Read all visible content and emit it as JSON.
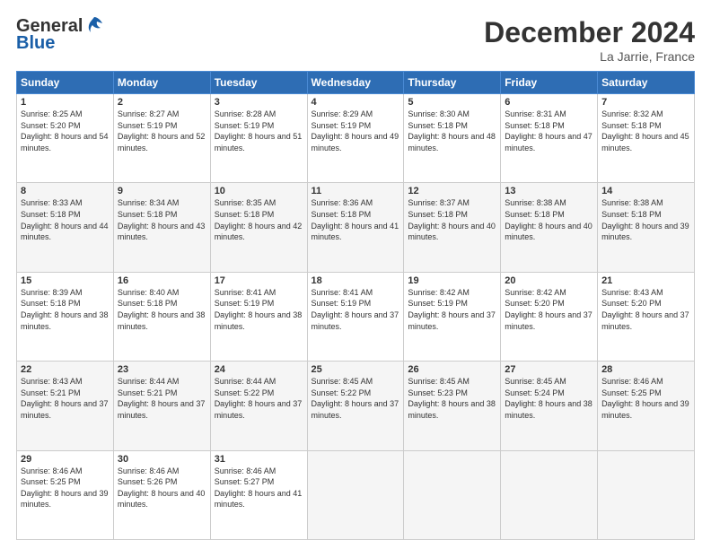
{
  "logo": {
    "line1": "General",
    "line2": "Blue"
  },
  "title": {
    "month": "December 2024",
    "location": "La Jarrie, France"
  },
  "headers": [
    "Sunday",
    "Monday",
    "Tuesday",
    "Wednesday",
    "Thursday",
    "Friday",
    "Saturday"
  ],
  "weeks": [
    [
      {
        "day": "1",
        "sunrise": "8:25 AM",
        "sunset": "5:20 PM",
        "daylight": "8 hours and 54 minutes."
      },
      {
        "day": "2",
        "sunrise": "8:27 AM",
        "sunset": "5:19 PM",
        "daylight": "8 hours and 52 minutes."
      },
      {
        "day": "3",
        "sunrise": "8:28 AM",
        "sunset": "5:19 PM",
        "daylight": "8 hours and 51 minutes."
      },
      {
        "day": "4",
        "sunrise": "8:29 AM",
        "sunset": "5:19 PM",
        "daylight": "8 hours and 49 minutes."
      },
      {
        "day": "5",
        "sunrise": "8:30 AM",
        "sunset": "5:18 PM",
        "daylight": "8 hours and 48 minutes."
      },
      {
        "day": "6",
        "sunrise": "8:31 AM",
        "sunset": "5:18 PM",
        "daylight": "8 hours and 47 minutes."
      },
      {
        "day": "7",
        "sunrise": "8:32 AM",
        "sunset": "5:18 PM",
        "daylight": "8 hours and 45 minutes."
      }
    ],
    [
      {
        "day": "8",
        "sunrise": "8:33 AM",
        "sunset": "5:18 PM",
        "daylight": "8 hours and 44 minutes."
      },
      {
        "day": "9",
        "sunrise": "8:34 AM",
        "sunset": "5:18 PM",
        "daylight": "8 hours and 43 minutes."
      },
      {
        "day": "10",
        "sunrise": "8:35 AM",
        "sunset": "5:18 PM",
        "daylight": "8 hours and 42 minutes."
      },
      {
        "day": "11",
        "sunrise": "8:36 AM",
        "sunset": "5:18 PM",
        "daylight": "8 hours and 41 minutes."
      },
      {
        "day": "12",
        "sunrise": "8:37 AM",
        "sunset": "5:18 PM",
        "daylight": "8 hours and 40 minutes."
      },
      {
        "day": "13",
        "sunrise": "8:38 AM",
        "sunset": "5:18 PM",
        "daylight": "8 hours and 40 minutes."
      },
      {
        "day": "14",
        "sunrise": "8:38 AM",
        "sunset": "5:18 PM",
        "daylight": "8 hours and 39 minutes."
      }
    ],
    [
      {
        "day": "15",
        "sunrise": "8:39 AM",
        "sunset": "5:18 PM",
        "daylight": "8 hours and 38 minutes."
      },
      {
        "day": "16",
        "sunrise": "8:40 AM",
        "sunset": "5:18 PM",
        "daylight": "8 hours and 38 minutes."
      },
      {
        "day": "17",
        "sunrise": "8:41 AM",
        "sunset": "5:19 PM",
        "daylight": "8 hours and 38 minutes."
      },
      {
        "day": "18",
        "sunrise": "8:41 AM",
        "sunset": "5:19 PM",
        "daylight": "8 hours and 37 minutes."
      },
      {
        "day": "19",
        "sunrise": "8:42 AM",
        "sunset": "5:19 PM",
        "daylight": "8 hours and 37 minutes."
      },
      {
        "day": "20",
        "sunrise": "8:42 AM",
        "sunset": "5:20 PM",
        "daylight": "8 hours and 37 minutes."
      },
      {
        "day": "21",
        "sunrise": "8:43 AM",
        "sunset": "5:20 PM",
        "daylight": "8 hours and 37 minutes."
      }
    ],
    [
      {
        "day": "22",
        "sunrise": "8:43 AM",
        "sunset": "5:21 PM",
        "daylight": "8 hours and 37 minutes."
      },
      {
        "day": "23",
        "sunrise": "8:44 AM",
        "sunset": "5:21 PM",
        "daylight": "8 hours and 37 minutes."
      },
      {
        "day": "24",
        "sunrise": "8:44 AM",
        "sunset": "5:22 PM",
        "daylight": "8 hours and 37 minutes."
      },
      {
        "day": "25",
        "sunrise": "8:45 AM",
        "sunset": "5:22 PM",
        "daylight": "8 hours and 37 minutes."
      },
      {
        "day": "26",
        "sunrise": "8:45 AM",
        "sunset": "5:23 PM",
        "daylight": "8 hours and 38 minutes."
      },
      {
        "day": "27",
        "sunrise": "8:45 AM",
        "sunset": "5:24 PM",
        "daylight": "8 hours and 38 minutes."
      },
      {
        "day": "28",
        "sunrise": "8:46 AM",
        "sunset": "5:25 PM",
        "daylight": "8 hours and 39 minutes."
      }
    ],
    [
      {
        "day": "29",
        "sunrise": "8:46 AM",
        "sunset": "5:25 PM",
        "daylight": "8 hours and 39 minutes."
      },
      {
        "day": "30",
        "sunrise": "8:46 AM",
        "sunset": "5:26 PM",
        "daylight": "8 hours and 40 minutes."
      },
      {
        "day": "31",
        "sunrise": "8:46 AM",
        "sunset": "5:27 PM",
        "daylight": "8 hours and 41 minutes."
      },
      null,
      null,
      null,
      null
    ]
  ]
}
